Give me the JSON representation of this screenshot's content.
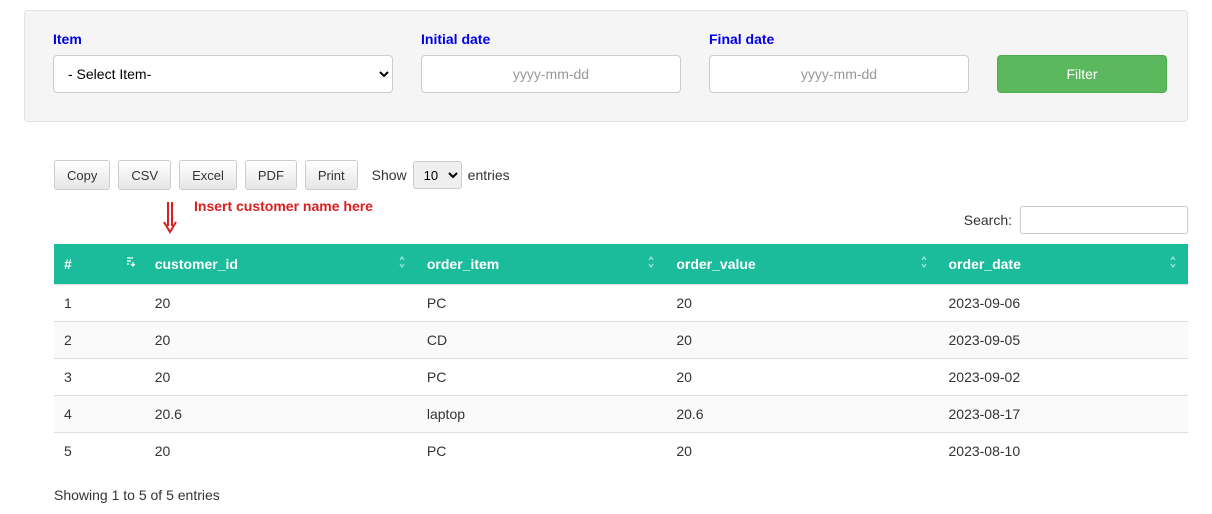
{
  "filter": {
    "item_label": "Item",
    "item_select_placeholder": "- Select Item-",
    "initial_date_label": "Initial date",
    "final_date_label": "Final date",
    "date_placeholder": "yyyy-mm-dd",
    "button_label": "Filter"
  },
  "toolbar": {
    "buttons": {
      "copy": "Copy",
      "csv": "CSV",
      "excel": "Excel",
      "pdf": "PDF",
      "print": "Print"
    },
    "show_label": "Show",
    "entries_label": "entries",
    "length_value": "10"
  },
  "annotation": {
    "text": "Insert customer name here"
  },
  "search": {
    "label": "Search:"
  },
  "table": {
    "columns": {
      "idx": "#",
      "customer_id": "customer_id",
      "order_item": "order_item",
      "order_value": "order_value",
      "order_date": "order_date"
    },
    "rows": [
      {
        "idx": "1",
        "customer_id": "20",
        "order_item": "PC",
        "order_value": "20",
        "order_date": "2023-09-06"
      },
      {
        "idx": "2",
        "customer_id": "20",
        "order_item": "CD",
        "order_value": "20",
        "order_date": "2023-09-05"
      },
      {
        "idx": "3",
        "customer_id": "20",
        "order_item": "PC",
        "order_value": "20",
        "order_date": "2023-09-02"
      },
      {
        "idx": "4",
        "customer_id": "20.6",
        "order_item": "laptop",
        "order_value": "20.6",
        "order_date": "2023-08-17"
      },
      {
        "idx": "5",
        "customer_id": "20",
        "order_item": "PC",
        "order_value": "20",
        "order_date": "2023-08-10"
      }
    ]
  },
  "info": {
    "text": "Showing 1 to 5 of 5 entries"
  }
}
